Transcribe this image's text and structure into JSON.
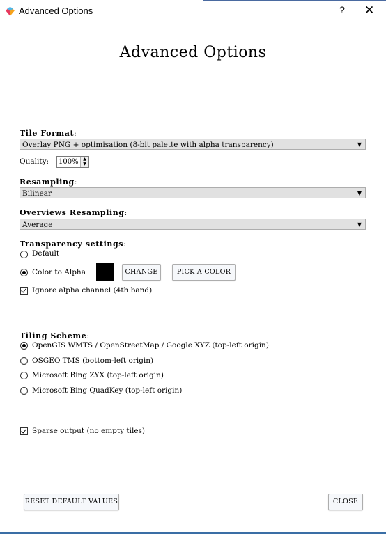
{
  "window": {
    "title": "Advanced Options",
    "help_label": "?",
    "close_label": "✕"
  },
  "heading": "Advanced Options",
  "tile_format": {
    "label": "Tile Format",
    "colon": ":",
    "selected": "Overlay PNG + optimisation (8-bit palette with alpha transparency)",
    "quality_label": "Quality:",
    "quality_value": "100%"
  },
  "resampling": {
    "label": "Resampling",
    "colon": ":",
    "selected": "Bilinear"
  },
  "overviews_resampling": {
    "label": "Overviews Resampling",
    "colon": ":",
    "selected": "Average"
  },
  "transparency": {
    "label": "Transparency settings",
    "colon": ":",
    "option_default": "Default",
    "option_color_alpha": "Color to Alpha",
    "selected": "Color to Alpha",
    "swatch_color": "#000000",
    "change_label": "CHANGE",
    "pick_label": "PICK A COLOR",
    "ignore_alpha_label": "Ignore alpha channel (4th band)",
    "ignore_alpha_checked": true
  },
  "tiling_scheme": {
    "label": "Tiling Scheme",
    "colon": ":",
    "options": [
      "OpenGIS WMTS / OpenStreetMap / Google XYZ (top-left origin)",
      "OSGEO TMS (bottom-left origin)",
      "Microsoft Bing ZYX (top-left origin)",
      "Microsoft Bing QuadKey (top-left origin)"
    ],
    "selected_index": 0
  },
  "sparse_output": {
    "label": "Sparse output (no empty tiles)",
    "checked": true
  },
  "buttons": {
    "reset": "RESET DEFAULT VALUES",
    "close": "CLOSE"
  },
  "colors": {
    "combo_bg": "#e1e1e1",
    "button_bg": "#f6f8fb",
    "accent": "#3a6ea5"
  }
}
